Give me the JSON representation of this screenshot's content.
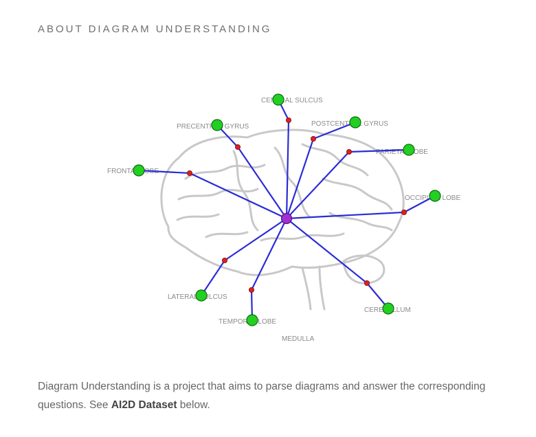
{
  "header": {
    "title": "ABOUT DIAGRAM UNDERSTANDING"
  },
  "diagram": {
    "labels": [
      "CENTRAL SULCUS",
      "PRECENTRAL GYRUS",
      "POSTCENTRAL GYRUS",
      "PARIETAL LOBE",
      "FRONTAL LOBE",
      "OCCIPITAL LOBE",
      "LATERAL SULCUS",
      "CEREBELLUM",
      "TEMPORAL LOBE",
      "MEDULLA"
    ],
    "colors": {
      "edge": "#2b2bd6",
      "label_node": "#22d022",
      "arrow_node": "#e02020",
      "center_node": "#a030d0",
      "brain": "#c8c8c8",
      "label_text": "#8a8a8a"
    }
  },
  "description": {
    "before": "Diagram Understanding is a project that aims to parse diagrams and answer the corresponding questions. See ",
    "bold": "AI2D Dataset",
    "after": " below."
  }
}
